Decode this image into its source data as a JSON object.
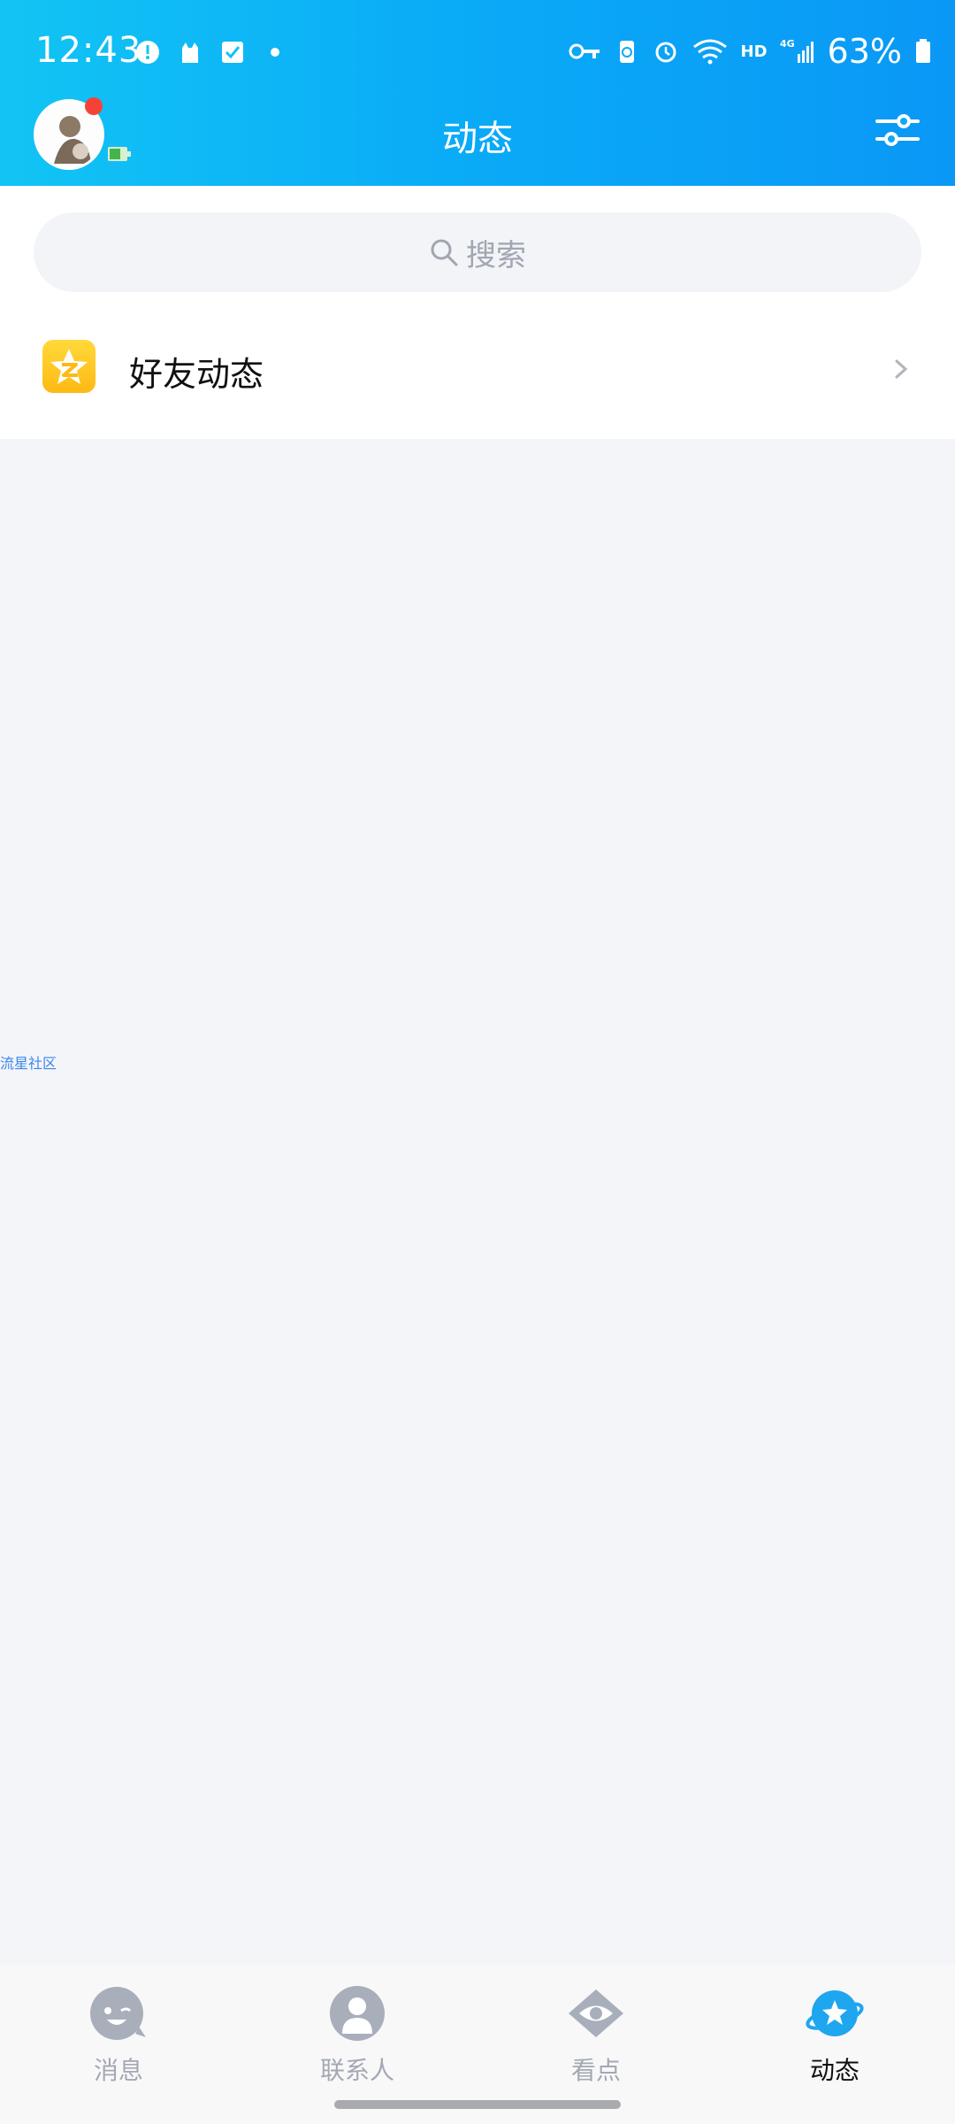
{
  "status_bar": {
    "time": "12:43",
    "network": "4G",
    "hd": "HD",
    "battery_percent": "63%",
    "left_icons": [
      "alert-icon",
      "cat-icon",
      "checkbox-icon",
      "dot-icon"
    ],
    "right_icons": [
      "key-icon",
      "recycle-battery-icon",
      "alarm-icon",
      "wifi-icon",
      "signal-icon",
      "battery-icon"
    ]
  },
  "header": {
    "title": "动态",
    "settings_icon": "filter-sliders-icon",
    "brand_color": "#0aaaf7"
  },
  "search": {
    "placeholder": "搜索"
  },
  "list": {
    "items": [
      {
        "label": "好友动态",
        "icon": "qzone-star-icon"
      }
    ]
  },
  "side_link": {
    "label": "流星社区"
  },
  "bottom_nav": {
    "tabs": [
      {
        "label": "消息",
        "icon": "message-face-icon",
        "active": false
      },
      {
        "label": "联系人",
        "icon": "contact-person-icon",
        "active": false
      },
      {
        "label": "看点",
        "icon": "eye-icon",
        "active": false
      },
      {
        "label": "动态",
        "icon": "planet-star-icon",
        "active": true
      }
    ]
  }
}
